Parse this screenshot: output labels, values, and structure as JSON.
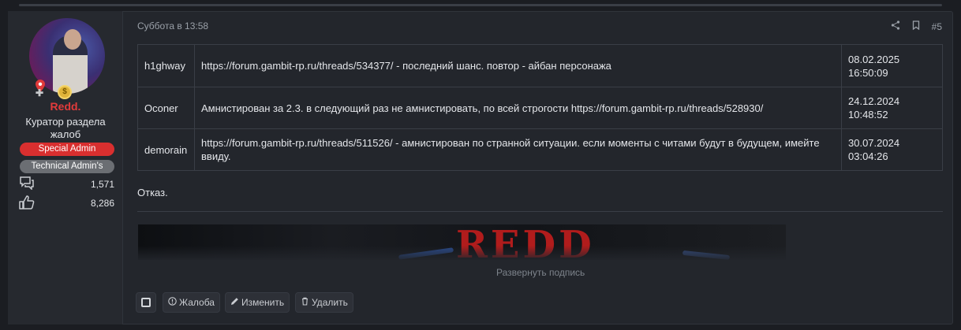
{
  "post": {
    "date": "Суббота в 13:58",
    "post_number": "#5",
    "share_icon": "share-icon",
    "bookmark_icon": "bookmark-icon"
  },
  "author": {
    "name": "Redd.",
    "title": "Куратор раздела жалоб",
    "banners": [
      {
        "label": "Special Admin",
        "color": "#d92f2f"
      },
      {
        "label": "Technical Admin's",
        "color": "#6b6e73"
      }
    ],
    "messages_count": "1,571",
    "reactions_count": "8,286"
  },
  "table": {
    "rows": [
      {
        "nick": "h1ghway",
        "text": "https://forum.gambit-rp.ru/threads/534377/ - последний шанс. повтор - айбан персонажа",
        "date": "08.02.2025",
        "time": "16:50:09"
      },
      {
        "nick": "Oconer",
        "text": "Амнистирован за 2.3. в следующий раз не амнистировать, по всей строгости https://forum.gambit-rp.ru/threads/528930/",
        "date": "24.12.2024",
        "time": "10:48:52"
      },
      {
        "nick": "demorain",
        "text": "https://forum.gambit-rp.ru/threads/511526/ - амнистирован по странной ситуации. если моменты с читами будут в будущем, имейте ввиду.",
        "date": "30.07.2024",
        "time": "03:04:26"
      }
    ]
  },
  "verdict": "Отказ.",
  "signature": {
    "image_text": "REDD",
    "expand_label": "Развернуть подпись"
  },
  "actions": {
    "report": "Жалоба",
    "edit": "Изменить",
    "delete": "Удалить"
  },
  "colors": {
    "accent_red": "#e23b3b",
    "background": "#1b1d22",
    "panel": "#23262c"
  }
}
